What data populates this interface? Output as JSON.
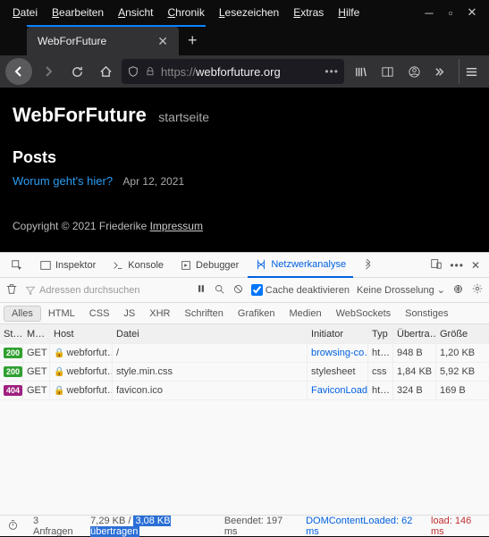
{
  "menubar": {
    "items": [
      "Datei",
      "Bearbeiten",
      "Ansicht",
      "Chronik",
      "Lesezeichen",
      "Extras",
      "Hilfe"
    ]
  },
  "tab": {
    "title": "WebForFuture"
  },
  "url": {
    "scheme": "https://",
    "domain": "webforfuture.org"
  },
  "page": {
    "title": "WebForFuture",
    "subtitle": "startseite",
    "posts_heading": "Posts",
    "post_title": "Worum geht's hier?",
    "post_date": "Apr 12, 2021",
    "copyright": "Copyright © 2021 Friederike ",
    "impressum": "Impressum"
  },
  "devtools": {
    "tabs": {
      "inspector": "Inspektor",
      "console": "Konsole",
      "debugger": "Debugger",
      "network": "Netzwerkanalyse"
    },
    "filter_placeholder": "Adressen durchsuchen",
    "disable_cache": "Cache deaktivieren",
    "throttle": "Keine Drosselung",
    "types": [
      "Alles",
      "HTML",
      "CSS",
      "JS",
      "XHR",
      "Schriften",
      "Grafiken",
      "Medien",
      "WebSockets",
      "Sonstiges"
    ],
    "headers": {
      "st": "St…",
      "me": "M…",
      "ho": "Host",
      "da": "Datei",
      "in": "Initiator",
      "ty": "Typ",
      "ub": "Übertra…",
      "gr": "Größe"
    },
    "rows": [
      {
        "status": "200",
        "status_kind": "ok",
        "method": "GET",
        "host": "webforfut…",
        "file": "/",
        "initiator": "browsing-co…",
        "initiator_link": true,
        "type": "ht…",
        "transferred": "948 B",
        "size": "1,20 KB"
      },
      {
        "status": "200",
        "status_kind": "ok",
        "method": "GET",
        "host": "webforfut…",
        "file": "style.min.css",
        "initiator": "stylesheet",
        "initiator_link": false,
        "type": "css",
        "transferred": "1,84 KB",
        "size": "5,92 KB"
      },
      {
        "status": "404",
        "status_kind": "err",
        "method": "GET",
        "host": "webforfut…",
        "file": "favicon.ico",
        "initiator": "FaviconLoad…",
        "initiator_link": true,
        "type": "ht…",
        "transferred": "324 B",
        "size": "169 B"
      }
    ],
    "status": {
      "requests": "3 Anfragen",
      "size_a": "7,29 KB / ",
      "size_b": "3,08 KB übertragen",
      "finish": "Beendet: 197 ms",
      "dom": "DOMContentLoaded: 62 ms",
      "load": "load: 146 ms"
    }
  }
}
